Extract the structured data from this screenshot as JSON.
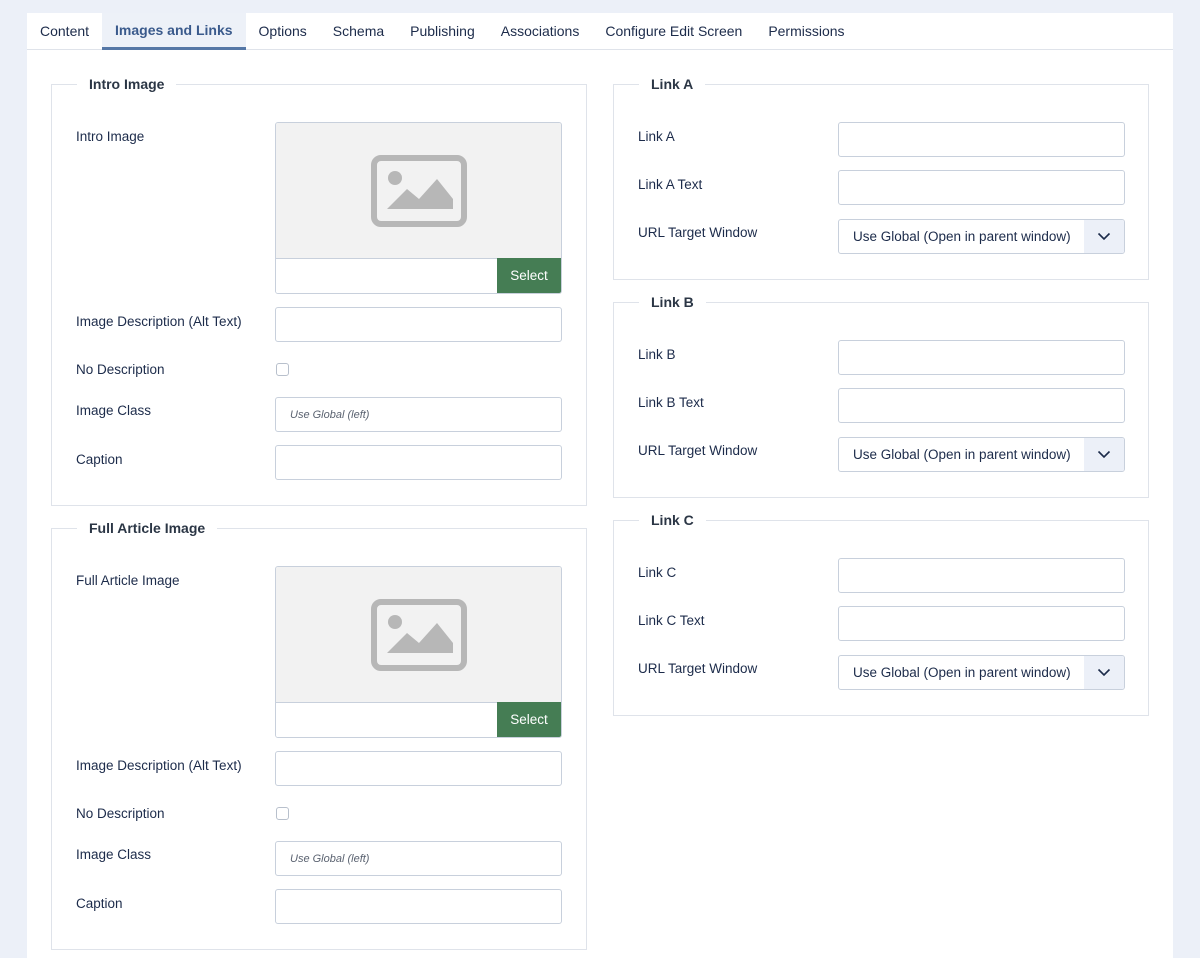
{
  "tabs": [
    {
      "label": "Content"
    },
    {
      "label": "Images and Links"
    },
    {
      "label": "Options"
    },
    {
      "label": "Schema"
    },
    {
      "label": "Publishing"
    },
    {
      "label": "Associations"
    },
    {
      "label": "Configure Edit Screen"
    },
    {
      "label": "Permissions"
    }
  ],
  "intro": {
    "legend": "Intro Image",
    "image_label": "Intro Image",
    "select_label": "Select",
    "alt_label": "Image Description (Alt Text)",
    "nodesc_label": "No Description",
    "class_label": "Image Class",
    "class_placeholder": "Use Global (left)",
    "caption_label": "Caption"
  },
  "full": {
    "legend": "Full Article Image",
    "image_label": "Full Article Image",
    "select_label": "Select",
    "alt_label": "Image Description (Alt Text)",
    "nodesc_label": "No Description",
    "class_label": "Image Class",
    "class_placeholder": "Use Global (left)",
    "caption_label": "Caption"
  },
  "link_a": {
    "legend": "Link A",
    "link_label": "Link A",
    "text_label": "Link A Text",
    "target_label": "URL Target Window",
    "target_value": "Use Global (Open in parent window)"
  },
  "link_b": {
    "legend": "Link B",
    "link_label": "Link B",
    "text_label": "Link B Text",
    "target_label": "URL Target Window",
    "target_value": "Use Global (Open in parent window)"
  },
  "link_c": {
    "legend": "Link C",
    "link_label": "Link C",
    "text_label": "Link C Text",
    "target_label": "URL Target Window",
    "target_value": "Use Global (Open in parent window)"
  },
  "colors": {
    "select_button": "#457d54",
    "active_tab_text": "#3a5a8c",
    "active_tab_underline": "#5577a6",
    "page_background": "#ecf0f8"
  },
  "icons": {
    "image_placeholder": "image-placeholder-icon",
    "dropdown": "chevron-down-icon"
  }
}
